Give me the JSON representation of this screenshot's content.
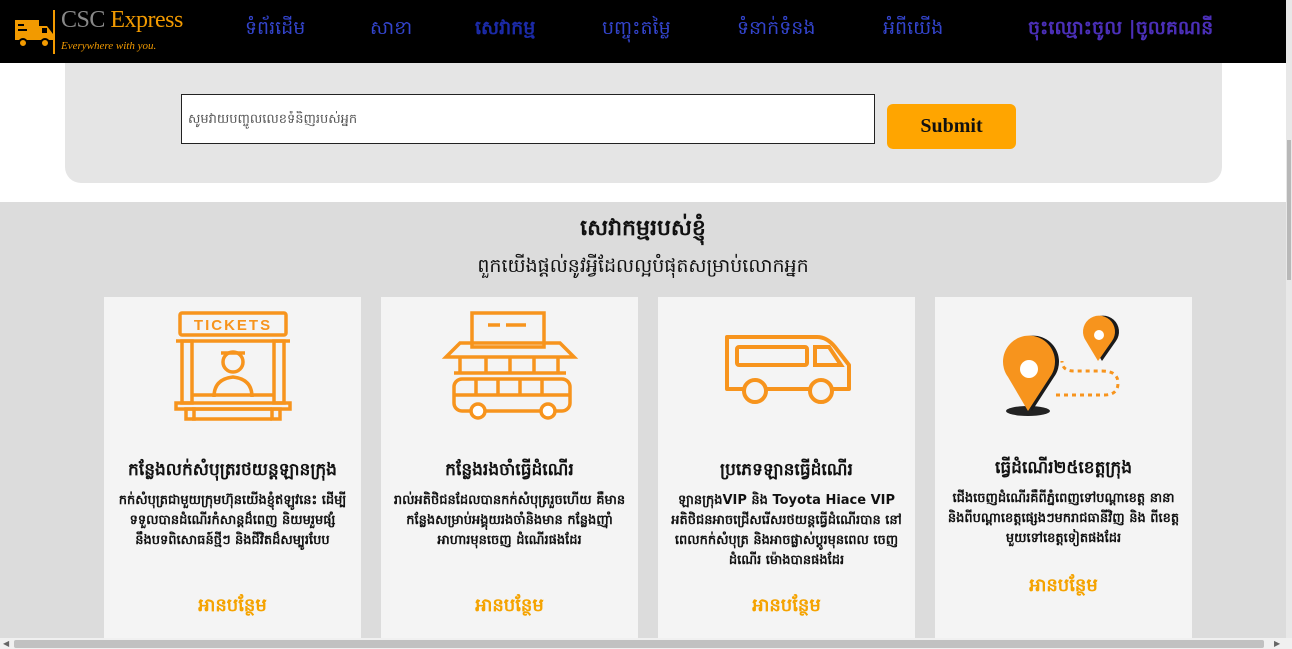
{
  "brand": {
    "title_part1": "CSC ",
    "title_part2": "Express",
    "tagline": "Everywhere with you."
  },
  "nav": {
    "home": "ទំព័រដើម",
    "branch": "សាខា",
    "services": "សេវាកម្ម",
    "price": "បញ្ចុះតម្លៃ",
    "contact": "ទំនាក់ទំនង",
    "about": "អំពីយើង",
    "login": "ចុះឈ្មោះចូល |ចូលគណនី"
  },
  "search": {
    "placeholder": "សូមវាយបញ្ចូលលេខទំនិញរបស់អ្នក",
    "submit_label": "Submit"
  },
  "services": {
    "title": "សេវាកម្មរបស់ខ្ញុំ",
    "subtitle": "ពួកយើងផ្តល់នូវអ្វីដែលល្អបំផុតសម្រាប់លោកអ្នក",
    "cards": [
      {
        "icon": "ticket-booth-icon",
        "title": "កន្លែងលក់សំបុត្ររថយន្តឡានក្រុង",
        "desc": "កក់សំបុត្រជាមួយក្រុមហ៊ុនយើងខ្ញុំឥឡូវនេះ ដើម្បីទទួលបានដំណើរកំសាន្តដ៏ពេញ និយមរួមផ្សំនឹងបទពិសោធន៍ថ្មីៗ និងជីវិតដ៏សម្បូរបែប",
        "link": "អានបន្ថែម"
      },
      {
        "icon": "bus-station-icon",
        "title": "កន្លែងរងចាំធ្វើដំណើរ",
        "desc": "រាល់អតិថិជនដែលបានកក់សំបុត្ររួចហើយ គឺមានកន្លែងសម្រាប់អង្គុយរងចាំនិងមាន កន្លែងញ៉ាំអាហារមុនចេញ ដំណើរផងដែរ",
        "link": "អានបន្ថែម"
      },
      {
        "icon": "van-icon",
        "title": "ប្រភេទឡានធ្វើដំណើរ",
        "desc": "ឡានក្រុងVIP និង Toyota Hiace VIP អតិថិជនអាចជ្រើសរើសរថយន្តធ្វើដំណើរបាន នៅពេលកក់សំបុត្រ និងអាចផ្លាស់ប្តូរមុនពេល ចេញដំណើរ​ ម៉ោងបានផងដែរ",
        "link": "អានបន្ថែម"
      },
      {
        "icon": "map-route-icon",
        "title": "ធ្វើដំណើរ២៥ខេត្តក្រុង",
        "desc": "ជើងចេញដំណើរគឺពីភ្នំពេញទៅបណ្តាខេត្ត នានានិងពីបណ្តាខេត្តផ្សេងៗមករាជធានីវិញ និង ពីខេត្តមួយទៅខេត្តទៀតផងដែរ",
        "link": "អានបន្ថែម"
      }
    ]
  },
  "colors": {
    "accent": "#ffa500",
    "navbar_bg": "#000000",
    "nav_link": "#3344cc"
  }
}
